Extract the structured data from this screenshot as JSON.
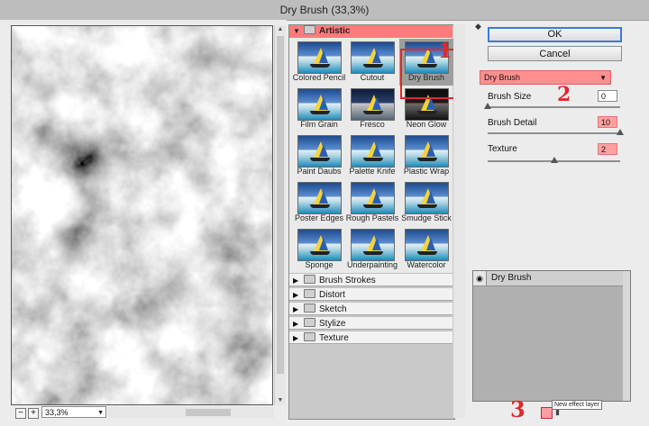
{
  "title": "Dry Brush (33,3%)",
  "preview": {
    "zoom": "33,3%",
    "zoom_out": "−",
    "zoom_in": "+"
  },
  "gallery": {
    "expanded_category": "Artistic",
    "filters": [
      {
        "label": "Colored Pencil"
      },
      {
        "label": "Cutout"
      },
      {
        "label": "Dry Brush"
      },
      {
        "label": "Film Grain"
      },
      {
        "label": "Fresco"
      },
      {
        "label": "Neon Glow"
      },
      {
        "label": "Paint Daubs"
      },
      {
        "label": "Palette Knife"
      },
      {
        "label": "Plastic Wrap"
      },
      {
        "label": "Poster Edges"
      },
      {
        "label": "Rough Pastels"
      },
      {
        "label": "Smudge Stick"
      },
      {
        "label": "Sponge"
      },
      {
        "label": "Underpainting"
      },
      {
        "label": "Watercolor"
      }
    ],
    "selected_filter": "Dry Brush",
    "categories": [
      "Brush Strokes",
      "Distort",
      "Sketch",
      "Stylize",
      "Texture"
    ]
  },
  "buttons": {
    "ok": "OK",
    "cancel": "Cancel"
  },
  "settings": {
    "filter_select": "Dry Brush",
    "params": [
      {
        "label": "Brush Size",
        "value": "0",
        "level": 0
      },
      {
        "label": "Brush Detail",
        "value": "10",
        "level": 1.0
      },
      {
        "label": "Texture",
        "value": "2",
        "level": 0.5
      }
    ]
  },
  "layers": {
    "items": [
      {
        "label": "Dry Brush"
      }
    ],
    "tooltip": "New effect layer"
  },
  "annotations": {
    "one": "1",
    "two": "2",
    "three": "3"
  },
  "colors": {
    "highlight": "#ff8f8f",
    "annotation": "#e0282d",
    "selection_border": "#e0282d"
  }
}
